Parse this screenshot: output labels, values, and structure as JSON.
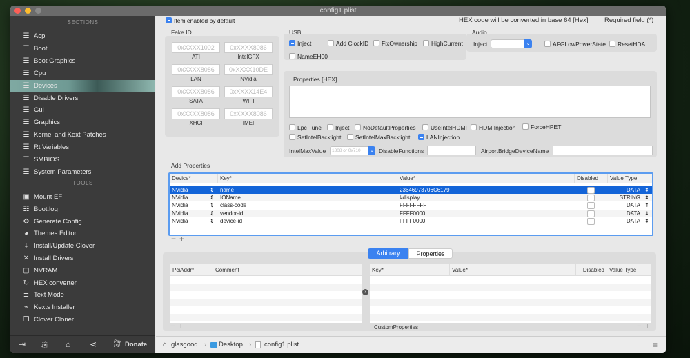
{
  "window": {
    "title": "config1.plist"
  },
  "sidebar": {
    "sections_header": "SECTIONS",
    "sections": [
      {
        "label": "Acpi"
      },
      {
        "label": "Boot"
      },
      {
        "label": "Boot Graphics"
      },
      {
        "label": "Cpu"
      },
      {
        "label": "Devices",
        "selected": true
      },
      {
        "label": "Disable Drivers"
      },
      {
        "label": "Gui"
      },
      {
        "label": "Graphics"
      },
      {
        "label": "Kernel and Kext Patches"
      },
      {
        "label": "Rt Variables"
      },
      {
        "label": "SMBIOS"
      },
      {
        "label": "System Parameters"
      }
    ],
    "tools_header": "TOOLS",
    "tools": [
      {
        "label": "Mount EFI",
        "icon": "disk-icon"
      },
      {
        "label": "Boot.log",
        "icon": "log-search-icon"
      },
      {
        "label": "Generate Config",
        "icon": "gears-icon"
      },
      {
        "label": "Themes Editor",
        "icon": "palette-icon"
      },
      {
        "label": "Install/Update Clover",
        "icon": "download-icon"
      },
      {
        "label": "Install Drivers",
        "icon": "tools-icon"
      },
      {
        "label": "NVRAM",
        "icon": "chip-icon"
      },
      {
        "label": "HEX converter",
        "icon": "refresh-icon"
      },
      {
        "label": "Text Mode",
        "icon": "text-lines-icon"
      },
      {
        "label": "Kexts Installer",
        "icon": "plug-icon"
      },
      {
        "label": "Clover Cloner",
        "icon": "copy-icon"
      }
    ],
    "bottom": {
      "paypal": "Pay Pal",
      "donate": "Donate"
    }
  },
  "header": {
    "item_enabled": "Item enabled by default",
    "hex_note": "HEX code will be converted in base 64 [Hex]",
    "required_note": "Required field (*)"
  },
  "fake_id": {
    "title": "Fake ID",
    "fields": [
      {
        "label": "ATI",
        "placeholder": "0xXXXX1002"
      },
      {
        "label": "IntelGFX",
        "placeholder": "0xXXXX8086"
      },
      {
        "label": "LAN",
        "placeholder": "0xXXXX8086"
      },
      {
        "label": "NVidia",
        "placeholder": "0xXXXX10DE"
      },
      {
        "label": "SATA",
        "placeholder": "0xXXXX8086"
      },
      {
        "label": "WIFI",
        "placeholder": "0xXXXX14E4"
      },
      {
        "label": "XHCI",
        "placeholder": "0xXXXX8086"
      },
      {
        "label": "IMEI",
        "placeholder": "0xXXXX8086"
      }
    ]
  },
  "usb": {
    "title": "USB",
    "options": [
      {
        "label": "Inject",
        "checked": true
      },
      {
        "label": "Add ClockID",
        "checked": false
      },
      {
        "label": "FixOwnership",
        "checked": false
      },
      {
        "label": "HighCurrent",
        "checked": false
      },
      {
        "label": "NameEH00",
        "checked": false
      }
    ]
  },
  "audio": {
    "title": "Audio",
    "inject_label": "Inject",
    "inject_value": "",
    "options": [
      {
        "label": "AFGLowPowerState",
        "checked": false
      },
      {
        "label": "ResetHDA",
        "checked": false
      }
    ]
  },
  "properties": {
    "title": "Properties [HEX]",
    "value": "",
    "options": [
      {
        "label": "Lpc Tune",
        "checked": false
      },
      {
        "label": "Inject",
        "checked": false
      },
      {
        "label": "NoDefaultProperties",
        "checked": false
      },
      {
        "label": "UseIntelHDMI",
        "checked": false
      },
      {
        "label": "HDMIInjection",
        "checked": false
      },
      {
        "label": "ForceHPET",
        "checked": false
      },
      {
        "label": "SetIntelBacklight",
        "checked": false
      },
      {
        "label": "SetIntelMaxBacklight",
        "checked": false
      },
      {
        "label": "LANInjection",
        "checked": true
      }
    ],
    "intel_max_label": "IntelMaxValue",
    "intel_max_placeholder": "1808 or 0x710",
    "disable_functions_label": "DisableFunctions",
    "airport_label": "AirportBridgeDeviceName"
  },
  "add_properties": {
    "title": "Add Properties",
    "columns": [
      "Device*",
      "Key*",
      "Value*",
      "Disabled",
      "Value Type"
    ],
    "rows": [
      {
        "device": "NVidia",
        "key": "name",
        "value": "23646973706C6179",
        "disabled": false,
        "type": "DATA"
      },
      {
        "device": "NVidia",
        "key": "IOName",
        "value": "#display",
        "disabled": false,
        "type": "STRING"
      },
      {
        "device": "NVidia",
        "key": "class-code",
        "value": "FFFFFFFF",
        "disabled": false,
        "type": "DATA"
      },
      {
        "device": "NVidia",
        "key": "vendor-id",
        "value": "FFFF0000",
        "disabled": false,
        "type": "DATA"
      },
      {
        "device": "NVidia",
        "key": "device-id",
        "value": "FFFF0000",
        "disabled": false,
        "type": "DATA"
      }
    ],
    "minus": "−",
    "plus": "+"
  },
  "lower": {
    "tabs": [
      {
        "label": "Arbitrary",
        "active": true
      },
      {
        "label": "Properties",
        "active": false
      }
    ],
    "left_columns": [
      "PciAddr*",
      "Comment"
    ],
    "right_columns": [
      "Key*",
      "Value*",
      "Disabled",
      "Value Type"
    ],
    "custom_properties": "CustomProperties"
  },
  "statusbar": {
    "path": [
      "glasgood",
      "Desktop",
      "config1.plist"
    ],
    "sep": "›"
  },
  "colors": {
    "accent": "#1364d8",
    "sidebar": "#3b3b3b",
    "selected_item": "#7fa9a2"
  }
}
